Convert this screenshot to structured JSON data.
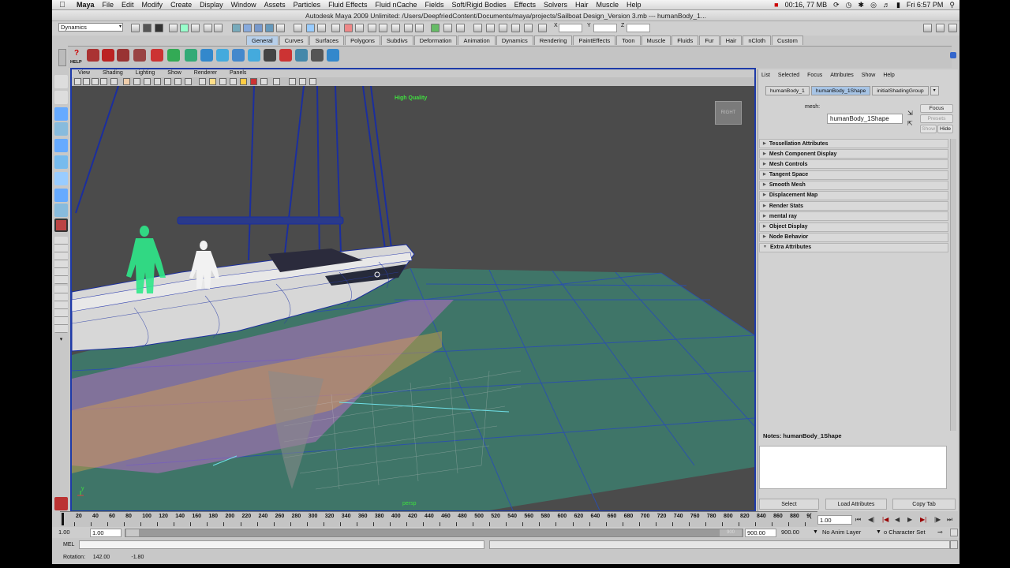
{
  "menubar": {
    "app": "Maya",
    "items": [
      "File",
      "Edit",
      "Modify",
      "Create",
      "Display",
      "Window",
      "Assets",
      "Particles",
      "Fluid Effects",
      "Fluid nCache",
      "Fields",
      "Soft/Rigid Bodies",
      "Effects",
      "Solvers",
      "Hair",
      "Muscle",
      "Help"
    ],
    "status_memory": "00:16, 77 MB",
    "clock": "Fri 6:57 PM"
  },
  "window": {
    "title": "Autodesk Maya 2009 Unlimited: /Users/DeepfriedContent/Documents/maya/projects/Sailboat Design_Version 3.mb   ---   humanBody_1..."
  },
  "statusline": {
    "mode": "Dynamics",
    "x_label": "X",
    "y_label": "Y",
    "z_label": "Z"
  },
  "shelf": {
    "tabs": [
      "General",
      "Curves",
      "Surfaces",
      "Polygons",
      "Subdivs",
      "Deformation",
      "Animation",
      "Dynamics",
      "Rendering",
      "PaintEffects",
      "Toon",
      "Muscle",
      "Fluids",
      "Fur",
      "Hair",
      "nCloth",
      "Custom"
    ],
    "active_tab": "General",
    "help_label": "HELP"
  },
  "panel": {
    "menu": [
      "View",
      "Shading",
      "Lighting",
      "Show",
      "Renderer",
      "Panels"
    ],
    "hud_quality": "High Quality",
    "camera_name": "persp",
    "viewcube_label": "RIGHT",
    "axis_label": "y"
  },
  "attribute_editor": {
    "menu": [
      "List",
      "Selected",
      "Focus",
      "Attributes",
      "Show",
      "Help"
    ],
    "tabs": [
      "humanBody_1",
      "humanBody_1Shape",
      "initialShadingGroup"
    ],
    "active_tab": "humanBody_1Shape",
    "mesh_label": "mesh:",
    "mesh_value": "humanBody_1Shape",
    "buttons": {
      "focus": "Focus",
      "presets": "Presets",
      "show": "Show",
      "hide": "Hide"
    },
    "sections": [
      {
        "label": "Tessellation Attributes",
        "expanded": false
      },
      {
        "label": "Mesh Component Display",
        "expanded": false
      },
      {
        "label": "Mesh Controls",
        "expanded": false
      },
      {
        "label": "Tangent Space",
        "expanded": false
      },
      {
        "label": "Smooth Mesh",
        "expanded": false
      },
      {
        "label": "Displacement Map",
        "expanded": false
      },
      {
        "label": "Render Stats",
        "expanded": false
      },
      {
        "label": "mental ray",
        "expanded": false
      },
      {
        "label": "Object Display",
        "expanded": false
      },
      {
        "label": "Node Behavior",
        "expanded": false
      },
      {
        "label": "Extra Attributes",
        "expanded": true
      }
    ],
    "notes_label": "Notes:  humanBody_1Shape",
    "bottom_buttons": [
      "Select",
      "Load Attributes",
      "Copy Tab"
    ]
  },
  "timeline": {
    "ticks": [
      "20",
      "40",
      "60",
      "80",
      "100",
      "120",
      "140",
      "160",
      "180",
      "200",
      "220",
      "240",
      "260",
      "280",
      "300",
      "320",
      "340",
      "360",
      "380",
      "400",
      "420",
      "440",
      "460",
      "480",
      "500",
      "520",
      "540",
      "560",
      "580",
      "600",
      "620",
      "640",
      "660",
      "680",
      "700",
      "720",
      "740",
      "760",
      "780",
      "800",
      "820",
      "840",
      "860",
      "880",
      "9("
    ],
    "current_time": "1.00"
  },
  "range": {
    "start": "1.00",
    "inner_start": "1.00",
    "handle_end": "900",
    "inner_end": "900.00",
    "end": "900.00",
    "anim_layer": "No Anim Layer",
    "character_set": "o Character Set"
  },
  "command": {
    "lang": "MEL"
  },
  "helpline": {
    "text": "Rotation:     142.00              -1.80"
  },
  "colors": {
    "viewport_border": "#1e3aa8",
    "grid_plane": "#3f7a6e",
    "selected_figure": "#2fe88a",
    "hud_text": "#3fe03f",
    "active_tab": "#b7cfe9"
  }
}
